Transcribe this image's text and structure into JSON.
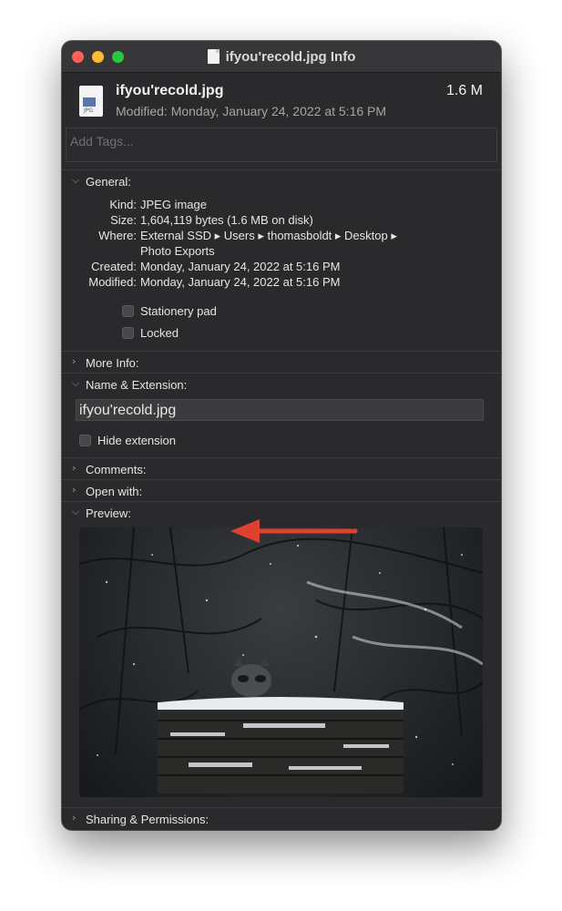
{
  "window": {
    "title": "ifyou'recold.jpg Info"
  },
  "header": {
    "filename": "ifyou'recold.jpg",
    "size": "1.6 M",
    "modified": "Modified: Monday, January 24, 2022 at 5:16 PM",
    "file_icon_tag": "JPG"
  },
  "tags": {
    "placeholder": "Add Tags..."
  },
  "general": {
    "label": "General:",
    "rows": [
      {
        "key": "Kind:",
        "value": "JPEG image"
      },
      {
        "key": "Size:",
        "value": "1,604,119 bytes (1.6 MB on disk)"
      },
      {
        "key": "Where:",
        "value": "External SSD ▸ Users ▸ thomasboldt ▸ Desktop ▸"
      },
      {
        "key": "",
        "value": "Photo Exports"
      },
      {
        "key": "Created:",
        "value": "Monday, January 24, 2022 at 5:16 PM"
      },
      {
        "key": "Modified:",
        "value": "Monday, January 24, 2022 at 5:16 PM"
      }
    ],
    "stationery_label": "Stationery pad",
    "locked_label": "Locked"
  },
  "sections": {
    "more_info": "More Info:",
    "name_ext": "Name & Extension:",
    "comments": "Comments:",
    "open_with": "Open with:",
    "preview": "Preview:",
    "sharing": "Sharing & Permissions:"
  },
  "name_ext": {
    "value": "ifyou'recold.jpg",
    "hide_extension_label": "Hide extension"
  },
  "colors": {
    "window_bg": "#2a2a2c",
    "annotation_arrow": "#e0412f"
  }
}
